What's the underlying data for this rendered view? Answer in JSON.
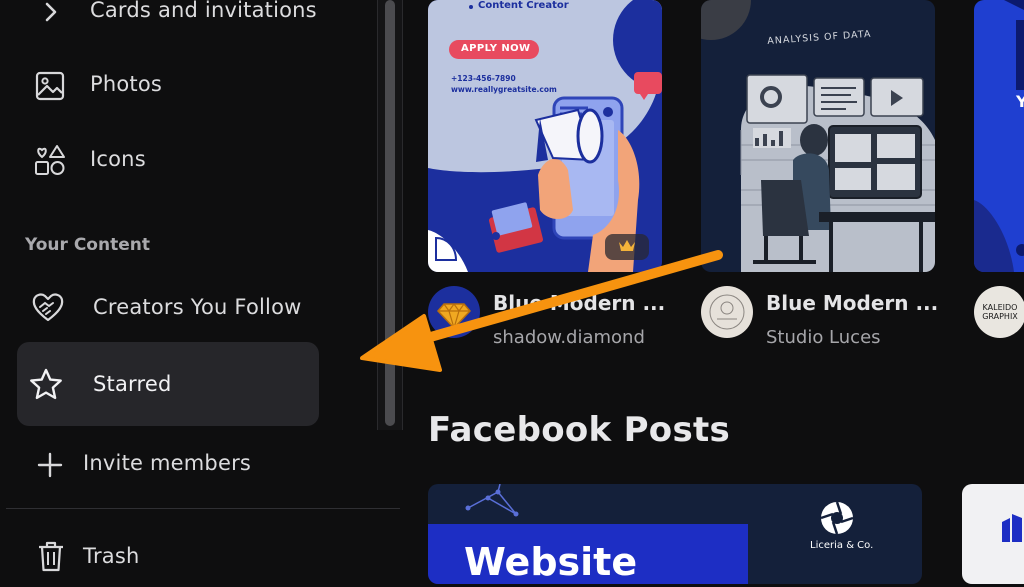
{
  "sidebar": {
    "items": [
      {
        "label": "Cards and invitations",
        "icon": "chevron-right-icon"
      },
      {
        "label": "Photos",
        "icon": "image-icon"
      },
      {
        "label": "Icons",
        "icon": "shapes-icon"
      }
    ],
    "section_title": "Your Content",
    "content_items": [
      {
        "label": "Creators You Follow",
        "icon": "heart-handshake-icon"
      },
      {
        "label": "Starred",
        "icon": "star-icon"
      },
      {
        "label": "Invite members",
        "icon": "plus-icon"
      },
      {
        "label": "Trash",
        "icon": "trash-icon"
      }
    ]
  },
  "cards": [
    {
      "title": "Blue Modern ...",
      "author": "shadow.diamond",
      "preview": {
        "bullet": "Content Creator",
        "button": "APPLY NOW",
        "phone": "+123-456-7890",
        "url": "www.reallygreatsite.com"
      }
    },
    {
      "title": "Blue Modern ...",
      "author": "Studio Luces",
      "preview": {
        "heading": "ANALYSIS OF DATA"
      }
    },
    {
      "title": "",
      "author": "",
      "avatar_text": [
        "KALEIDO",
        "GRAPHIX"
      ],
      "preview": {
        "letter": "Y"
      }
    }
  ],
  "sections": {
    "facebook_posts": "Facebook Posts"
  },
  "facebook_card": {
    "headline": "Website",
    "brand": "Liceria & Co."
  },
  "colors": {
    "background": "#0e0e0f",
    "selected_bg": "#26262a",
    "arrow": "#f7930f",
    "apply_button": "#e84a5f",
    "preview_blue": "#1c2f9e",
    "preview_navy": "#14203a"
  }
}
